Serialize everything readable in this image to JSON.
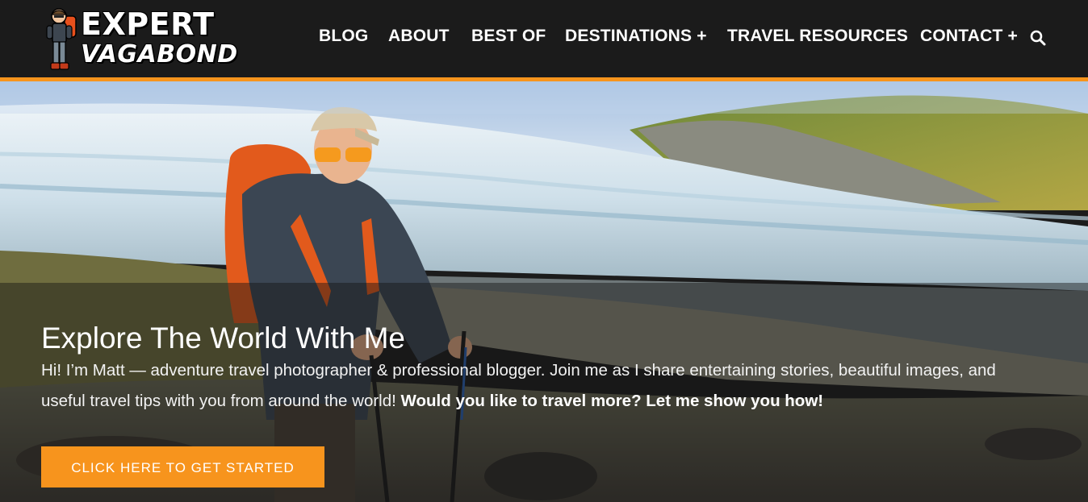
{
  "logo": {
    "line1": "EXPERT",
    "line2": "VAGABOND"
  },
  "nav": {
    "items": [
      {
        "label": "BLOG"
      },
      {
        "label": "ABOUT"
      },
      {
        "label": "BEST OF"
      },
      {
        "label": "DESTINATIONS +"
      },
      {
        "label": "TRAVEL RESOURCES"
      },
      {
        "label": "CONTACT +"
      }
    ],
    "search_icon": "search-icon"
  },
  "hero": {
    "title": "Explore The World With Me",
    "intro": "Hi! I’m Matt — adventure travel photographer & professional blogger. Join me as I share entertaining stories, beautiful images, and useful travel tips with you from around the world!",
    "intro_bold": "Would you like to travel more? Let me show you how!",
    "cta_label": "CLICK HERE TO GET STARTED"
  },
  "colors": {
    "accent": "#f7941d",
    "header_bg": "#1b1b1b"
  }
}
